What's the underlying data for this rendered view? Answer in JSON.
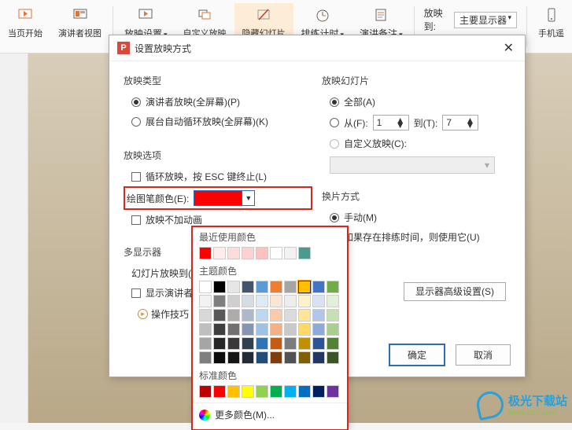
{
  "ribbon": {
    "items": [
      {
        "label": "当页开始"
      },
      {
        "label": "演讲者视图"
      },
      {
        "label": "放映设置"
      },
      {
        "label": "自定义放映"
      },
      {
        "label": "隐藏幻灯片"
      },
      {
        "label": "排练计时"
      },
      {
        "label": "演讲备注"
      }
    ],
    "display_label": "放映到:",
    "display_value": "主要显示器",
    "show_presenter": "显示演讲者视图",
    "phone": "手机遥"
  },
  "dialog": {
    "title": "设置放映方式",
    "g_type": "放映类型",
    "r_presenter": "演讲者放映(全屏幕)(P)",
    "r_kiosk": "展台自动循环放映(全屏幕)(K)",
    "g_opts": "放映选项",
    "c_loop": "循环放映，按 ESC 键终止(L)",
    "pen_label": "绘图笔颜色(E):",
    "c_noanim": "放映不加动画",
    "g_multi": "多显示器",
    "multi_to": "幻灯片放映到(O",
    "c_showpres": "显示演讲者视",
    "g_slides": "放映幻灯片",
    "r_all": "全部(A)",
    "r_from": "从(F):",
    "from_v": "1",
    "to_lbl": "到(T):",
    "to_v": "7",
    "r_custom": "自定义放映(C):",
    "g_advance": "换片方式",
    "r_manual": "手动(M)",
    "r_timing": "如果存在排练时间，则使用它(U)",
    "adv_btn": "显示器高级设置(S)",
    "ok": "确定",
    "cancel": "取消",
    "tips": "操作技巧"
  },
  "pop": {
    "recent": "最近使用颜色",
    "theme": "主题颜色",
    "standard": "标准颜色",
    "more": "更多颜色(M)...",
    "recent_colors": [
      "#ff0000",
      "#ffecec",
      "#ffdcdc",
      "#ffd0d0",
      "#ffc0c0",
      "#ffffff",
      "#f2f2f2",
      "#4a9a8f"
    ],
    "theme_row": [
      "#ffffff",
      "#000000",
      "#e7e6e6",
      "#44546a",
      "#5b9bd5",
      "#ed7d31",
      "#a5a5a5",
      "#ffc000",
      "#4472c4",
      "#70ad47"
    ],
    "theme_shades": [
      [
        "#f2f2f2",
        "#7f7f7f",
        "#d0cece",
        "#d6dce4",
        "#deebf6",
        "#fbe5d5",
        "#ededed",
        "#fff2cc",
        "#d9e2f3",
        "#e2efd9"
      ],
      [
        "#d8d8d8",
        "#595959",
        "#aeabab",
        "#adb9ca",
        "#bdd7ee",
        "#f7cbac",
        "#dbdbdb",
        "#fee599",
        "#b4c6e7",
        "#c5e0b3"
      ],
      [
        "#bfbfbf",
        "#3f3f3f",
        "#757070",
        "#8496b0",
        "#9cc3e5",
        "#f4b183",
        "#c9c9c9",
        "#ffd965",
        "#8eaadb",
        "#a8d08d"
      ],
      [
        "#a5a5a5",
        "#262626",
        "#3a3838",
        "#323f4f",
        "#2e75b5",
        "#c55a11",
        "#7b7b7b",
        "#bf9000",
        "#2f5496",
        "#538135"
      ],
      [
        "#7f7f7f",
        "#0c0c0c",
        "#171616",
        "#222a35",
        "#1e4e79",
        "#833c0b",
        "#525252",
        "#7f6000",
        "#1f3864",
        "#375623"
      ]
    ],
    "standard_colors": [
      "#c00000",
      "#ff0000",
      "#ffc000",
      "#ffff00",
      "#92d050",
      "#00b050",
      "#00b0f0",
      "#0070c0",
      "#002060",
      "#7030a0"
    ]
  }
}
